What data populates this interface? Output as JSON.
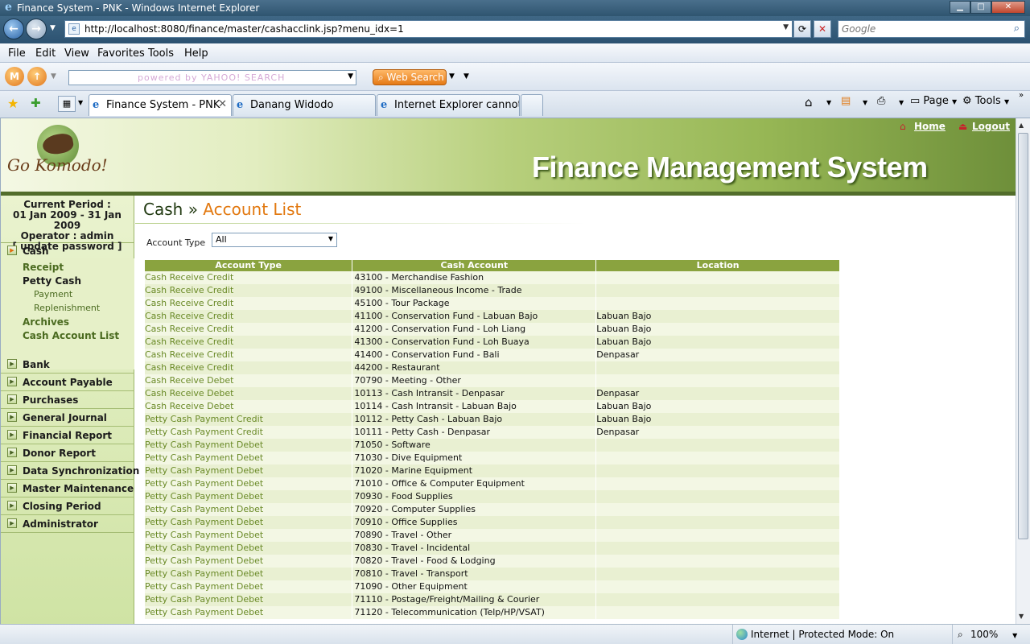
{
  "window": {
    "title": "Finance System - PNK - Windows Internet Explorer"
  },
  "address_bar": {
    "url": "http://localhost:8080/finance/master/cashacclink.jsp?menu_idx=1",
    "search_placeholder": "Google"
  },
  "menu": [
    "File",
    "Edit",
    "View",
    "Favorites",
    "Tools",
    "Help"
  ],
  "yahoo_toolbar": {
    "search_placeholder": "powered by YAHOO! SEARCH",
    "web_search_label": "Web Search"
  },
  "tabs": [
    {
      "label": "Finance System - PNK",
      "active": true
    },
    {
      "label": "Danang Widodo",
      "active": false
    },
    {
      "label": "Internet Explorer cannot di...",
      "active": false
    }
  ],
  "command_bar": {
    "page_label": "Page",
    "tools_label": "Tools"
  },
  "header": {
    "app_title": "Finance Management System",
    "logo_text": "Go Komodo!",
    "home_link": "Home",
    "logout_link": "Logout"
  },
  "sidebar": {
    "period_label": "Current Period :",
    "period_value": "01 Jan 2009 - 31 Jan 2009",
    "operator": "Operator : admin",
    "update_password": "[ update password ]",
    "cash": {
      "label": "Cash",
      "items": {
        "receipt": "Receipt",
        "petty_cash": "Petty Cash",
        "payment": "Payment",
        "replenishment": "Replenishment",
        "archives": "Archives",
        "cash_account_list": "Cash Account List"
      }
    },
    "sections": [
      "Bank",
      "Account Payable",
      "Purchases",
      "General Journal",
      "Financial Report",
      "Donor Report",
      "Data Synchronization",
      "Master Maintenance",
      "Closing Period",
      "Administrator"
    ]
  },
  "content": {
    "breadcrumb_root": "Cash",
    "breadcrumb_separator": "»",
    "page_title": "Account List",
    "filter_label": "Account Type",
    "filter_value": "All",
    "columns": [
      "Account Type",
      "Cash Account",
      "Location"
    ],
    "rows": [
      [
        "Cash Receive Credit",
        "43100 - Merchandise Fashion",
        ""
      ],
      [
        "Cash Receive Credit",
        "49100 - Miscellaneous Income - Trade",
        ""
      ],
      [
        "Cash Receive Credit",
        "45100 - Tour Package",
        ""
      ],
      [
        "Cash Receive Credit",
        "41100 - Conservation Fund - Labuan Bajo",
        "Labuan Bajo"
      ],
      [
        "Cash Receive Credit",
        "41200 - Conservation Fund - Loh Liang",
        "Labuan Bajo"
      ],
      [
        "Cash Receive Credit",
        "41300 - Conservation Fund - Loh Buaya",
        "Labuan Bajo"
      ],
      [
        "Cash Receive Credit",
        "41400 - Conservation Fund - Bali",
        "Denpasar"
      ],
      [
        "Cash Receive Credit",
        "44200 - Restaurant",
        ""
      ],
      [
        "Cash Receive Debet",
        "70790 - Meeting - Other",
        ""
      ],
      [
        "Cash Receive Debet",
        "10113 - Cash Intransit - Denpasar",
        "Denpasar"
      ],
      [
        "Cash Receive Debet",
        "10114 - Cash Intransit - Labuan Bajo",
        "Labuan Bajo"
      ],
      [
        "Petty Cash Payment Credit",
        "10112 - Petty Cash - Labuan Bajo",
        "Labuan Bajo"
      ],
      [
        "Petty Cash Payment Credit",
        "10111 - Petty Cash - Denpasar",
        "Denpasar"
      ],
      [
        "Petty Cash Payment Debet",
        "71050 - Software",
        ""
      ],
      [
        "Petty Cash Payment Debet",
        "71030 - Dive Equipment",
        ""
      ],
      [
        "Petty Cash Payment Debet",
        "71020 - Marine Equipment",
        ""
      ],
      [
        "Petty Cash Payment Debet",
        "71010 - Office & Computer Equipment",
        ""
      ],
      [
        "Petty Cash Payment Debet",
        "70930 - Food Supplies",
        ""
      ],
      [
        "Petty Cash Payment Debet",
        "70920 - Computer Supplies",
        ""
      ],
      [
        "Petty Cash Payment Debet",
        "70910 - Office Supplies",
        ""
      ],
      [
        "Petty Cash Payment Debet",
        "70890 - Travel - Other",
        ""
      ],
      [
        "Petty Cash Payment Debet",
        "70830 - Travel - Incidental",
        ""
      ],
      [
        "Petty Cash Payment Debet",
        "70820 - Travel - Food & Lodging",
        ""
      ],
      [
        "Petty Cash Payment Debet",
        "70810 - Travel - Transport",
        ""
      ],
      [
        "Petty Cash Payment Debet",
        "71090 - Other Equipment",
        ""
      ],
      [
        "Petty Cash Payment Debet",
        "71110 - Postage/Freight/Mailing & Courier",
        ""
      ],
      [
        "Petty Cash Payment Debet",
        "71120 - Telecommunication (Telp/HP/VSAT)",
        ""
      ]
    ]
  },
  "statusbar": {
    "zone": "Internet | Protected Mode: On",
    "zoom": "100%"
  }
}
